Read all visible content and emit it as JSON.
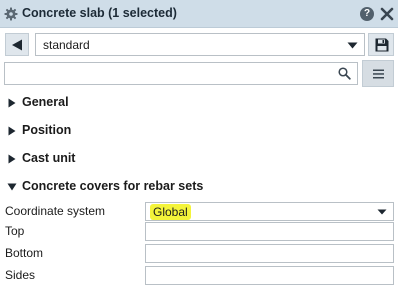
{
  "titlebar": {
    "title": "Concrete slab (1 selected)",
    "icons": [
      "gear-icon",
      "help-icon",
      "close-icon"
    ],
    "help_glyph": "?"
  },
  "toolbar": {
    "preset_value": "standard",
    "icons": [
      "back-arrow-icon",
      "chevron-down-icon",
      "save-icon"
    ]
  },
  "search": {
    "placeholder": "",
    "value": "",
    "icons": [
      "search-icon",
      "menu-icon"
    ]
  },
  "sections": [
    {
      "label": "General",
      "expanded": false
    },
    {
      "label": "Position",
      "expanded": false
    },
    {
      "label": "Cast unit",
      "expanded": false
    },
    {
      "label": "Concrete covers for rebar sets",
      "expanded": true
    }
  ],
  "properties": [
    {
      "label": "Coordinate system",
      "value": "Global",
      "type": "select",
      "highlighted": true
    },
    {
      "label": "Top",
      "value": "",
      "type": "text"
    },
    {
      "label": "Bottom",
      "value": "",
      "type": "text"
    },
    {
      "label": "Sides",
      "value": "",
      "type": "text"
    }
  ],
  "colors": {
    "titlebar_bg": "#cfdde8",
    "button_bg": "#dfe6ec",
    "highlight": "#f4f43a",
    "icon": "#3a4651"
  }
}
